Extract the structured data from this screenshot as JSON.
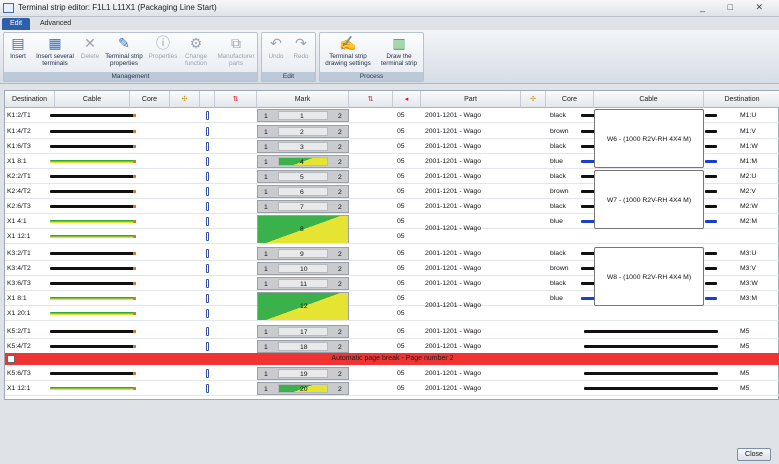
{
  "window": {
    "title": "Terminal strip editor: F1L1 L11X1 (Packaging Line Start)",
    "controls": "_ □ ✕"
  },
  "tabs": [
    "Edit",
    "Advanced"
  ],
  "ribbon": {
    "management": {
      "title": "Management",
      "buttons": [
        "Insert",
        "Insert several terminals",
        "Delete",
        "Terminal strip properties",
        "Properties",
        "Change function",
        "Manufacturer parts"
      ]
    },
    "edit": {
      "title": "Edit",
      "buttons": [
        "Undo",
        "Redo"
      ]
    },
    "process": {
      "title": "Process",
      "buttons": [
        "Terminal strip drawing settings",
        "Draw the terminal strip"
      ]
    }
  },
  "grid": {
    "headers": [
      "Destination",
      "Cable",
      "Core",
      "",
      "",
      "",
      "Mark",
      "",
      "",
      "Part",
      "",
      "Core",
      "Cable",
      "Destination"
    ],
    "rows": [
      {
        "dest": "K1:2/T1",
        "mark_l": "1",
        "mark": "1",
        "mark_r": "2",
        "page": "05",
        "part": "2001-1201 - Wago",
        "core": "black",
        "rdest": "M1:U"
      },
      {
        "dest": "K1:4/T2",
        "mark_l": "1",
        "mark": "2",
        "mark_r": "2",
        "page": "05",
        "part": "2001-1201 - Wago",
        "core": "brown",
        "rdest": "M1:V"
      },
      {
        "dest": "K1:6/T3",
        "mark_l": "1",
        "mark": "3",
        "mark_r": "2",
        "page": "05",
        "part": "2001-1201 - Wago",
        "core": "black",
        "rdest": "M1:W"
      },
      {
        "dest": "X1 8:1",
        "mark_l": "1",
        "mark": "4",
        "mark_r": "2",
        "page": "05",
        "part": "2001-1201 - Wago",
        "core": "blue",
        "rdest": "M1:M"
      },
      {
        "dest": "K2:2/T1",
        "mark_l": "1",
        "mark": "5",
        "mark_r": "2",
        "page": "05",
        "part": "2001-1201 - Wago",
        "core": "black",
        "rdest": "M2:U"
      },
      {
        "dest": "K2:4/T2",
        "mark_l": "1",
        "mark": "6",
        "mark_r": "2",
        "page": "05",
        "part": "2001-1201 - Wago",
        "core": "brown",
        "rdest": "M2:V"
      },
      {
        "dest": "K2:6/T3",
        "mark_l": "1",
        "mark": "7",
        "mark_r": "2",
        "page": "05",
        "part": "2001-1201 - Wago",
        "core": "black",
        "rdest": "M2:W"
      },
      {
        "dest": "X1 4:1",
        "mark_l": "",
        "mark": "8",
        "mark_r": "",
        "page": "05",
        "part": "2001-1201 - Wago",
        "core": "blue",
        "rdest": "M2:M"
      },
      {
        "dest": "X1 12:1",
        "page": "05"
      },
      {
        "dest": "K3:2/T1",
        "mark_l": "1",
        "mark": "9",
        "mark_r": "2",
        "page": "05",
        "part": "2001-1201 - Wago",
        "core": "black",
        "rdest": "M3:U"
      },
      {
        "dest": "K3:4/T2",
        "mark_l": "1",
        "mark": "10",
        "mark_r": "2",
        "page": "05",
        "part": "2001-1201 - Wago",
        "core": "brown",
        "rdest": "M3:V"
      },
      {
        "dest": "K3:6/T3",
        "mark_l": "1",
        "mark": "11",
        "mark_r": "2",
        "page": "05",
        "part": "2001-1201 - Wago",
        "core": "black",
        "rdest": "M3:W"
      },
      {
        "dest": "X1 8:1",
        "mark_l": "",
        "mark": "12",
        "mark_r": "",
        "page": "05",
        "part": "2001-1201 - Wago",
        "core": "blue",
        "rdest": "M3:M"
      },
      {
        "dest": "X1 20:1",
        "page": "05"
      },
      {
        "dest": "K5:2/T1",
        "mark_l": "1",
        "mark": "17",
        "mark_r": "2",
        "page": "05",
        "part": "2001-1201 - Wago",
        "core": "",
        "rdest": "M5"
      },
      {
        "dest": "K5:4/T2",
        "mark_l": "1",
        "mark": "18",
        "mark_r": "2",
        "page": "05",
        "part": "2001-1201 - Wago",
        "core": "",
        "rdest": "M5"
      },
      {
        "dest": "K5:6/T3",
        "mark_l": "1",
        "mark": "19",
        "mark_r": "2",
        "page": "05",
        "part": "2001-1201 - Wago",
        "core": "",
        "rdest": "M5"
      },
      {
        "dest": "X1 12:1",
        "mark_l": "1",
        "mark": "20",
        "mark_r": "2",
        "page": "05",
        "part": "2001-1201 - Wago",
        "core": "",
        "rdest": "M5"
      }
    ],
    "cables": [
      "W6 - (1000 R2V-RH 4X4 M)",
      "W7 - (1000 R2V-RH 4X4 M)",
      "W8 - (1000 R2V-RH 4X4 M)"
    ],
    "pagebreak": "Automatic page break - Page number 2"
  },
  "close_label": "Close"
}
